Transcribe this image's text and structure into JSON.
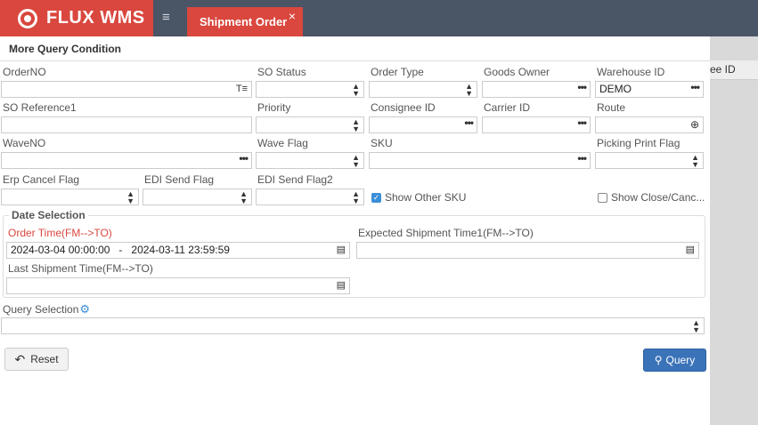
{
  "app": {
    "brand": "FLUX WMS",
    "tab": "Shipment Order",
    "tab_close": "×",
    "menu_icon": "≡"
  },
  "background": {
    "column_header": "ee ID"
  },
  "panel": {
    "title": "More Query Condition"
  },
  "labels": {
    "order_no": "OrderNO",
    "so_status": "SO Status",
    "order_type": "Order Type",
    "goods_owner": "Goods Owner",
    "warehouse_id": "Warehouse ID",
    "so_reference1": "SO Reference1",
    "priority": "Priority",
    "consignee_id": "Consignee ID",
    "carrier_id": "Carrier ID",
    "route": "Route",
    "wave_no": "WaveNO",
    "wave_flag": "Wave Flag",
    "sku": "SKU",
    "picking_print_flag": "Picking Print Flag",
    "erp_cancel_flag": "Erp Cancel Flag",
    "edi_send_flag": "EDI Send Flag",
    "edi_send_flag2": "EDI Send Flag2"
  },
  "values": {
    "warehouse_id": "DEMO"
  },
  "checkboxes": {
    "show_other_sku": "Show Other SKU",
    "show_close_cancel": "Show Close/Canc..."
  },
  "date_selection": {
    "legend": "Date Selection",
    "order_time_label": "Order Time(FM-->TO)",
    "order_time_value": "2024-03-04 00:00:00   -   2024-03-11 23:59:59",
    "expected_shipment_label": "Expected Shipment Time1(FM-->TO)",
    "last_shipment_label": "Last Shipment Time(FM-->TO)"
  },
  "query_selection": {
    "label": "Query Selection"
  },
  "buttons": {
    "reset": "Reset",
    "query": "Query"
  },
  "colors": {
    "brand_red": "#d9473e",
    "topbar": "#4a5566",
    "accent_blue": "#3b73b9",
    "required_red": "#d9473e"
  }
}
